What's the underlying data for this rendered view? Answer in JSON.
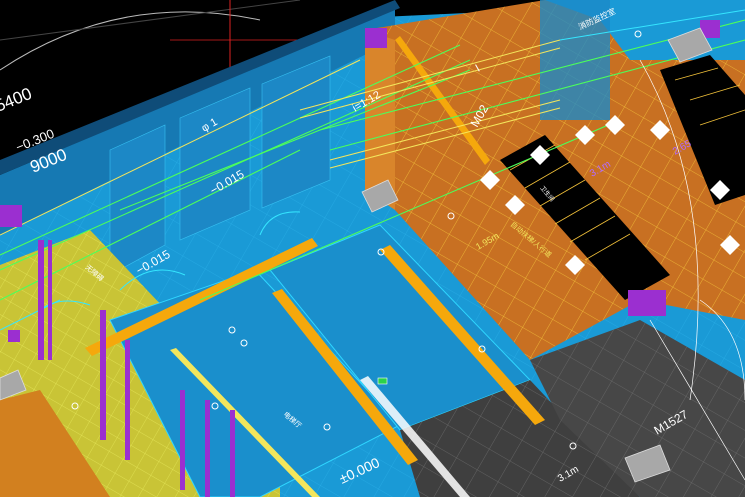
{
  "window": {
    "title": ""
  },
  "viewport": {
    "labels": {
      "dim_5400": "5400",
      "elev_neg0300": "−0.300",
      "dim_9000": "9000",
      "i_slope": "i=1:12",
      "phi1": "φ 1",
      "elev_neg0015_a": "−0.015",
      "elev_neg0015_b": "−0.015",
      "door_m02": "M02",
      "door_m1527": "M1527",
      "elev_pm0000": "±0.000",
      "h_195": "1.95m",
      "h_31a": "3.1m",
      "h_31b": "3.1m",
      "h_265": "2.65",
      "room_fire": "消防监控室",
      "room_elevator_hall": "电梯厅",
      "room_toilet": "无障碍",
      "room_note": "自动扶梯/人行道",
      "room_small": "卫生间",
      "axis_mark": "I"
    },
    "colors": {
      "background": "#000000",
      "floor_blue": "#1a9ad6",
      "floor_blue_dark": "#1679b3",
      "floor_orange": "#c87022",
      "floor_yellow": "#c9c436",
      "accent_magenta": "#9b2fd0",
      "grid_yellow": "#f3c23a",
      "line_green": "#4cff5a",
      "line_cyan": "#35e6ff",
      "floor_gray": "#3f3f3f"
    }
  }
}
